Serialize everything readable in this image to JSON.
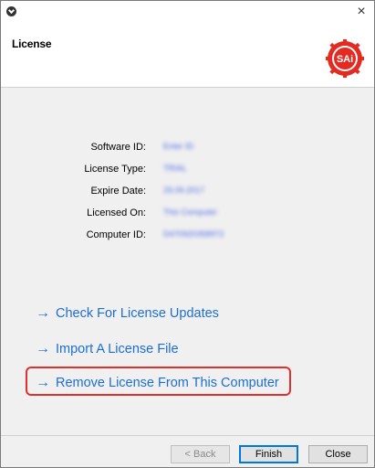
{
  "window": {
    "close_glyph": "×"
  },
  "header": {
    "title": "License",
    "logo_text": "SAi",
    "logo_color": "#e32b22"
  },
  "license_info": [
    {
      "label": "Software ID:",
      "value": "Enter ID"
    },
    {
      "label": "License Type:",
      "value": "TRIAL"
    },
    {
      "label": "Expire Date:",
      "value": "29.09.2017"
    },
    {
      "label": "Licensed On:",
      "value": "This Computer"
    },
    {
      "label": "Computer ID:",
      "value": "D470920358972"
    }
  ],
  "actions": {
    "check_updates": "Check For License Updates",
    "import_file": "Import A License File",
    "remove_license": "Remove License From This Computer"
  },
  "buttons": {
    "back": "< Back",
    "finish": "Finish",
    "close": "Close"
  },
  "colors": {
    "link": "#1c6fd1",
    "highlight": "#e0302c"
  }
}
